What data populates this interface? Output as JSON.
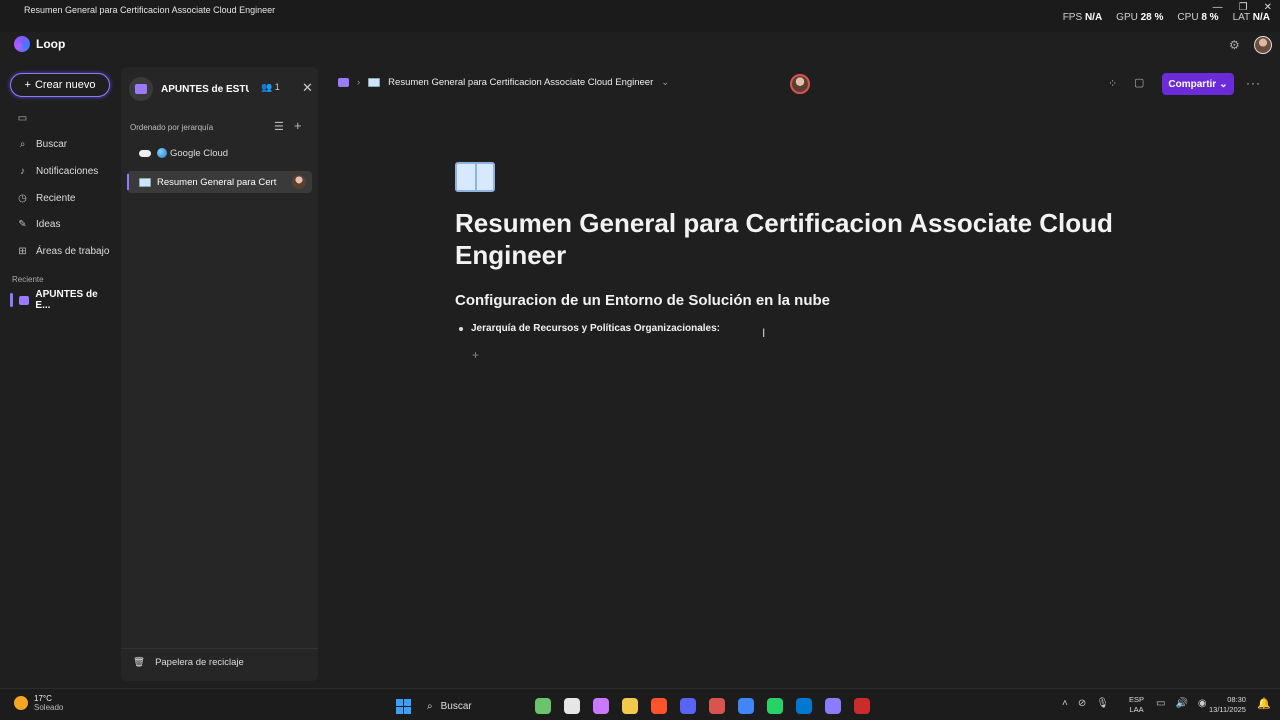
{
  "window": {
    "title": "Resumen General para Certificacion Associate Cloud Engineer",
    "controls": [
      "—",
      "❐",
      "✕"
    ]
  },
  "perf": {
    "fps_label": "FPS",
    "fps": "N/A",
    "gpu_label": "GPU",
    "gpu": "28 %",
    "cpu_label": "CPU",
    "cpu": "8 %",
    "lat_label": "LAT",
    "lat": "N/A"
  },
  "app": {
    "name": "Loop"
  },
  "leftnav": {
    "create_label": "Crear nuevo",
    "items": [
      {
        "label": "Buscar",
        "icon": "search-icon"
      },
      {
        "label": "Notificaciones",
        "icon": "bell-icon"
      },
      {
        "label": "Reciente",
        "icon": "clock-icon"
      },
      {
        "label": "Ideas",
        "icon": "pen-icon"
      },
      {
        "label": "Áreas de trabajo",
        "icon": "grid-icon"
      }
    ],
    "recent_label": "Reciente",
    "recent_item": "APUNTES de E..."
  },
  "panel": {
    "workspace_name": "APUNTES de ESTU...",
    "members": "1",
    "sort_label": "Ordenado por jerarquía",
    "tree": [
      {
        "label": "Google Cloud"
      },
      {
        "label": "Resumen General para Cert"
      }
    ],
    "trash_label": "Papelera de reciclaje"
  },
  "doc": {
    "breadcrumb": "Resumen General para Certificacion Associate Cloud Engineer",
    "share_label": "Compartir",
    "title": "Resumen General para Certificacion Associate Cloud Engineer",
    "heading": "Configuracion de un Entorno de Solución en la nube",
    "bullet": "Jerarquía de Recursos y Políticas Organizacionales:"
  },
  "taskbar": {
    "temp": "17°C",
    "weather": "Soleado",
    "search": "Buscar",
    "lang1": "ESP",
    "lang2": "LAA",
    "time": "08:30",
    "date": "13/11/2025",
    "app_colors": [
      "#6bc36b",
      "#e6e6e6",
      "#c879ff",
      "#f2c94c",
      "#fb542b",
      "#5865f2",
      "#d9534f",
      "#4285f4",
      "#25d366",
      "#0078d4",
      "#8b7bff",
      "#cc2b2b"
    ]
  }
}
